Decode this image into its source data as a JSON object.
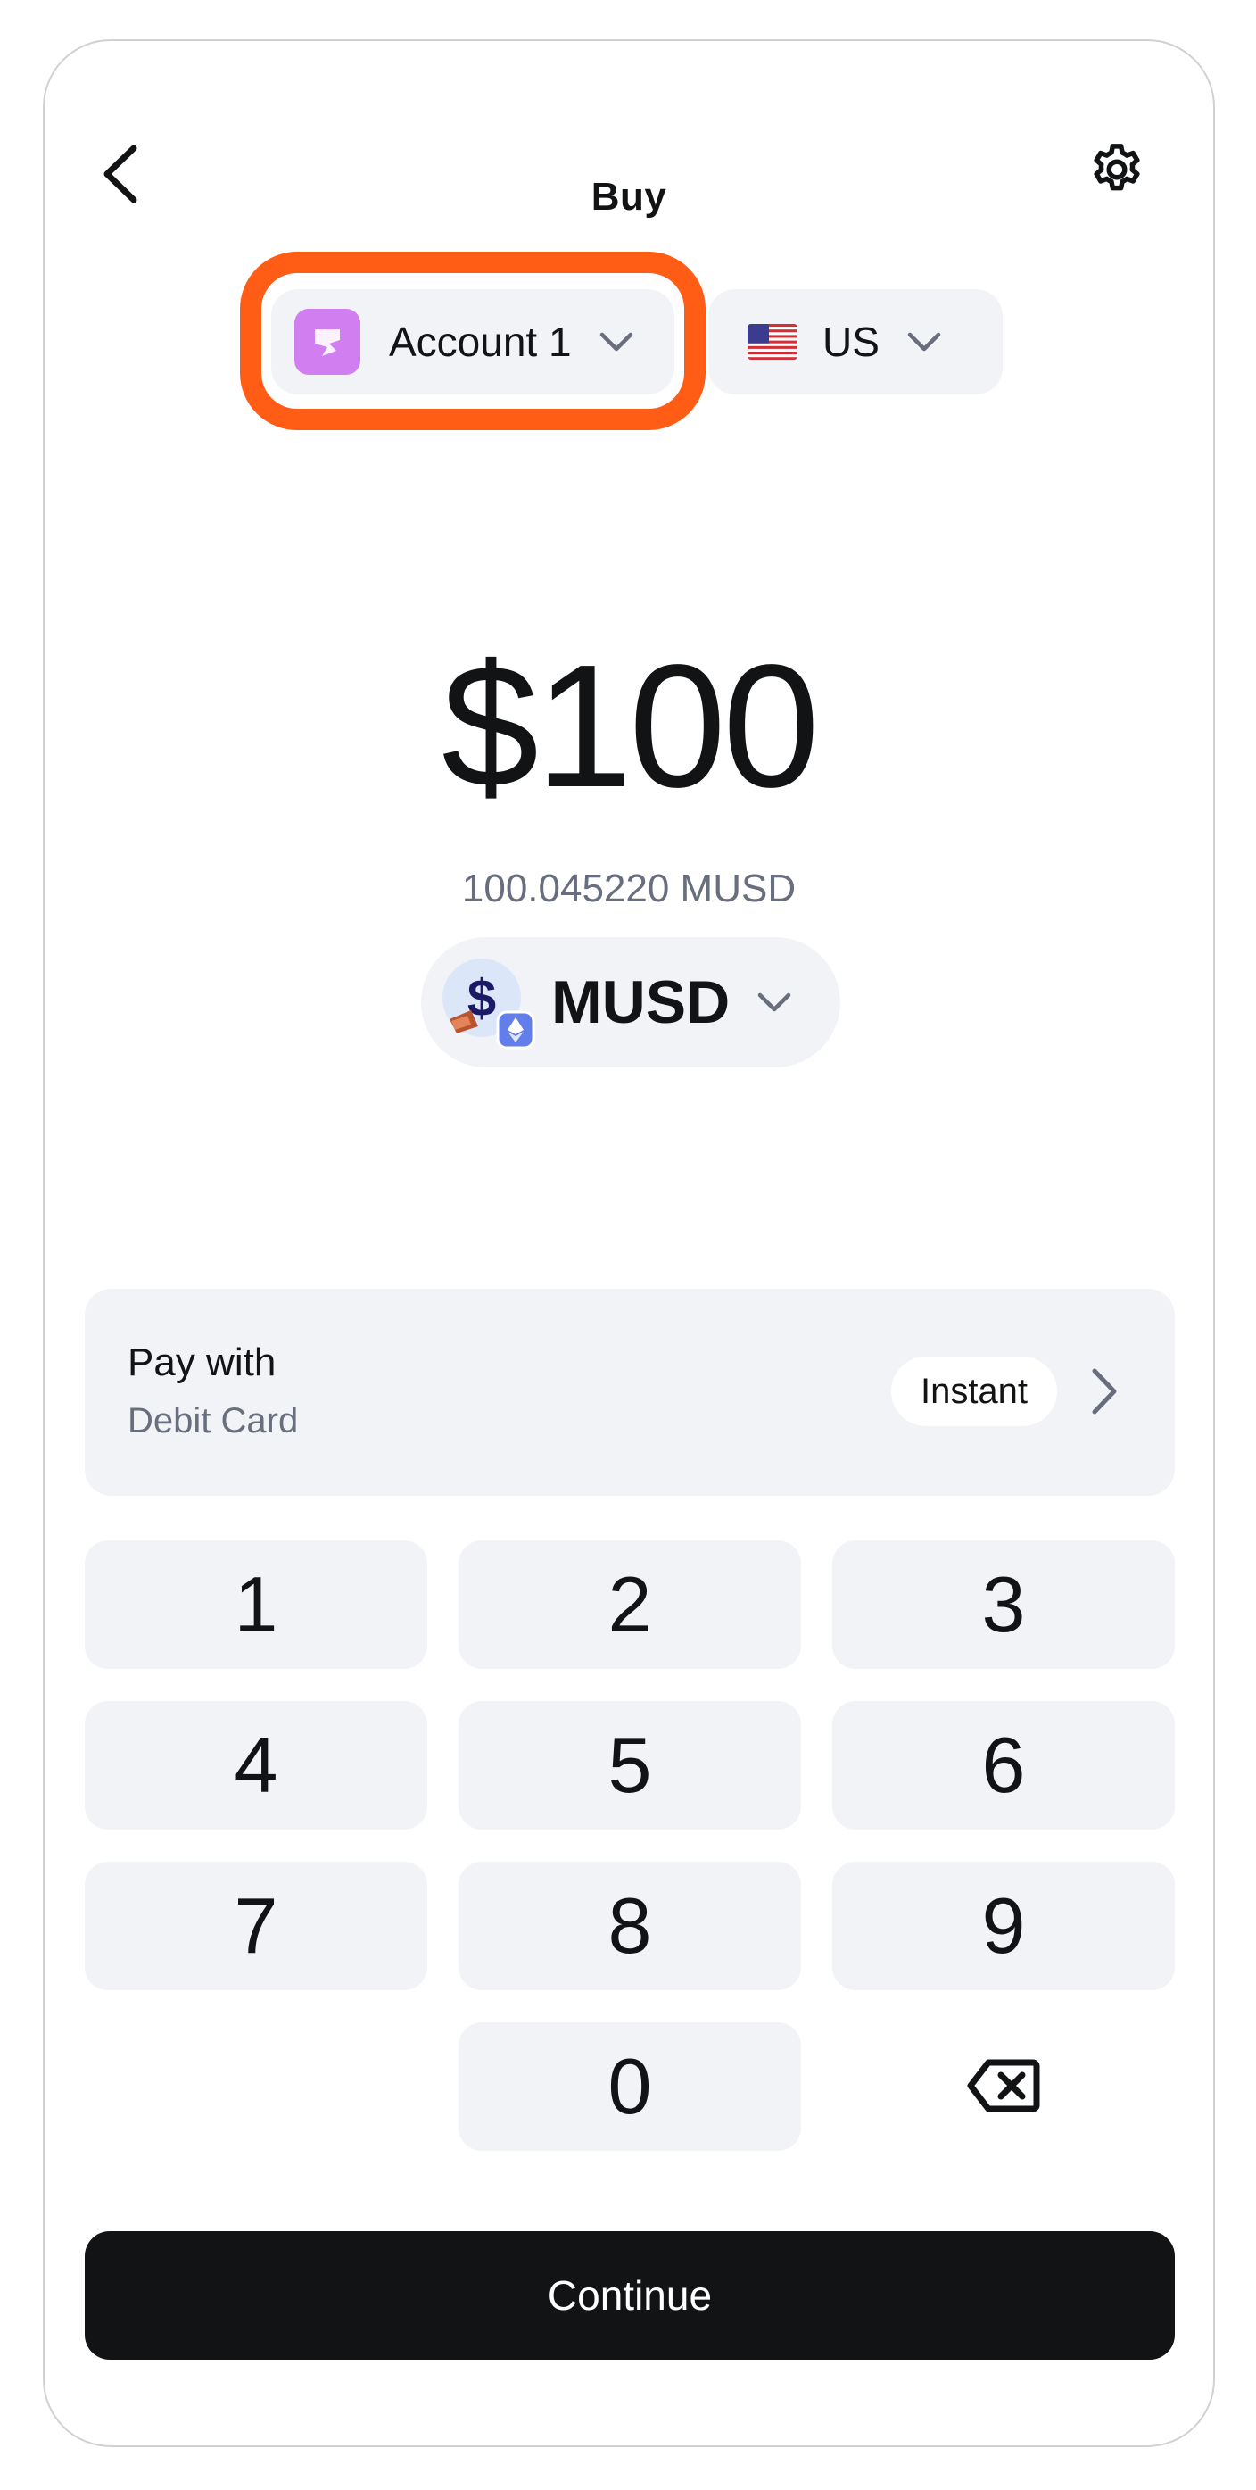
{
  "header": {
    "title": "Buy",
    "back_icon": "chevron-left-icon",
    "settings_icon": "gear-icon"
  },
  "account_selector": {
    "label": "Account 1",
    "avatar_color": "#d17ef0",
    "highlight_color": "#ff5c16"
  },
  "region_selector": {
    "flag": "us-flag-icon",
    "label": "US"
  },
  "amount": {
    "fiat": "$100",
    "converted": "100.045220 MUSD"
  },
  "token_selector": {
    "label": "MUSD",
    "icon": "musd-token-icon",
    "network_badge": "ethereum-icon"
  },
  "payment": {
    "title": "Pay with",
    "method": "Debit Card",
    "badge": "Instant"
  },
  "keypad": {
    "keys": [
      "1",
      "2",
      "3",
      "4",
      "5",
      "6",
      "7",
      "8",
      "9",
      "",
      "0",
      "⌫"
    ]
  },
  "actions": {
    "continue_label": "Continue"
  },
  "colors": {
    "surface": "#f2f3f7",
    "text": "#121314",
    "muted": "#686e7d",
    "primary_button": "#121314"
  }
}
